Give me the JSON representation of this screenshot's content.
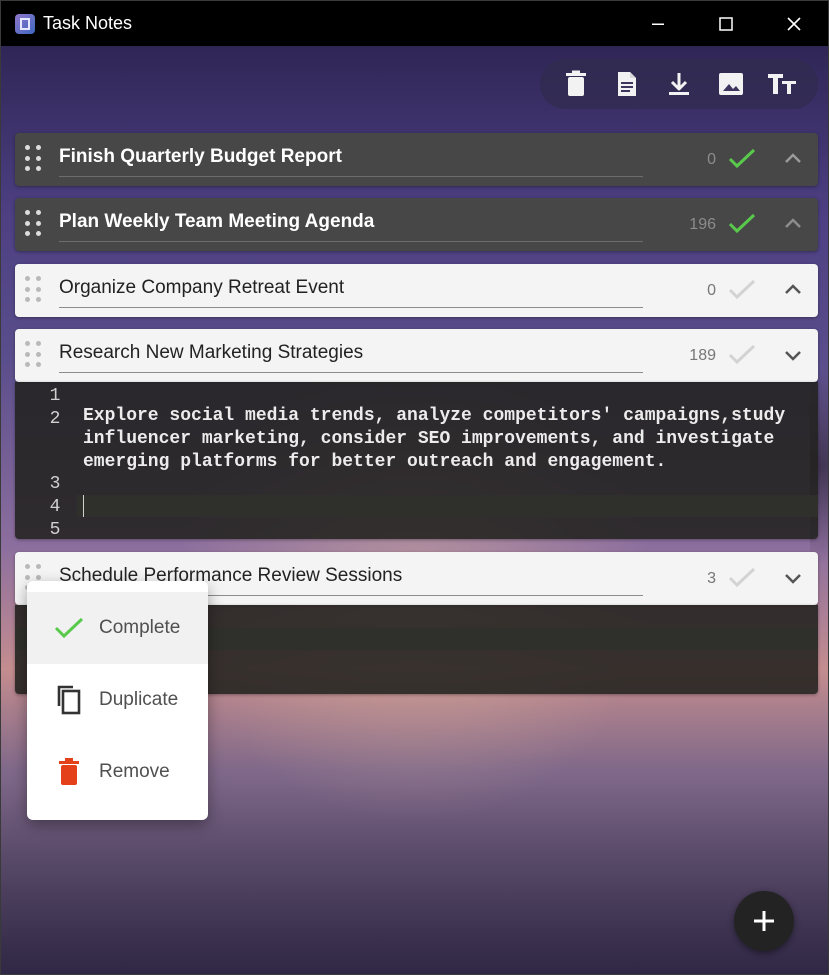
{
  "window": {
    "title": "Task Notes"
  },
  "toolbar": {
    "items": [
      {
        "name": "delete-all",
        "icon": "trash-icon"
      },
      {
        "name": "notes",
        "icon": "document-icon"
      },
      {
        "name": "download",
        "icon": "download-icon"
      },
      {
        "name": "image",
        "icon": "image-icon"
      },
      {
        "name": "text-size",
        "icon": "text-size-icon"
      }
    ]
  },
  "tasks": [
    {
      "title": "Finish Quarterly Budget Report",
      "count": "0",
      "completed": true,
      "collapsed": false
    },
    {
      "title": "Plan Weekly Team Meeting Agenda",
      "count": "196",
      "completed": true,
      "collapsed": false
    },
    {
      "title": "Organize Company Retreat Event",
      "count": "0",
      "completed": false,
      "collapsed": false
    },
    {
      "title": "Research New Marketing Strategies",
      "count": "189",
      "completed": false,
      "collapsed": true
    },
    {
      "title": "Schedule Performance Review Sessions",
      "count": "3",
      "completed": false,
      "collapsed": true
    }
  ],
  "editor": {
    "line_numbers": [
      "1",
      "2",
      "3",
      "4",
      "5"
    ],
    "line_2_text": "Explore social media trends, analyze competitors' campaigns,study influencer marketing, consider SEO improvements, and investigate emerging platforms for better outreach and engagement."
  },
  "context_menu": {
    "items": [
      {
        "label": "Complete",
        "icon": "check-icon"
      },
      {
        "label": "Duplicate",
        "icon": "copy-icon"
      },
      {
        "label": "Remove",
        "icon": "trash-icon"
      }
    ]
  },
  "colors": {
    "titlebar": "#000000",
    "dark_task": "#474747",
    "light_task": "#f4f4f4",
    "check_active": "#59c94c",
    "menu_remove": "#e4411b",
    "fab": "#232323"
  }
}
